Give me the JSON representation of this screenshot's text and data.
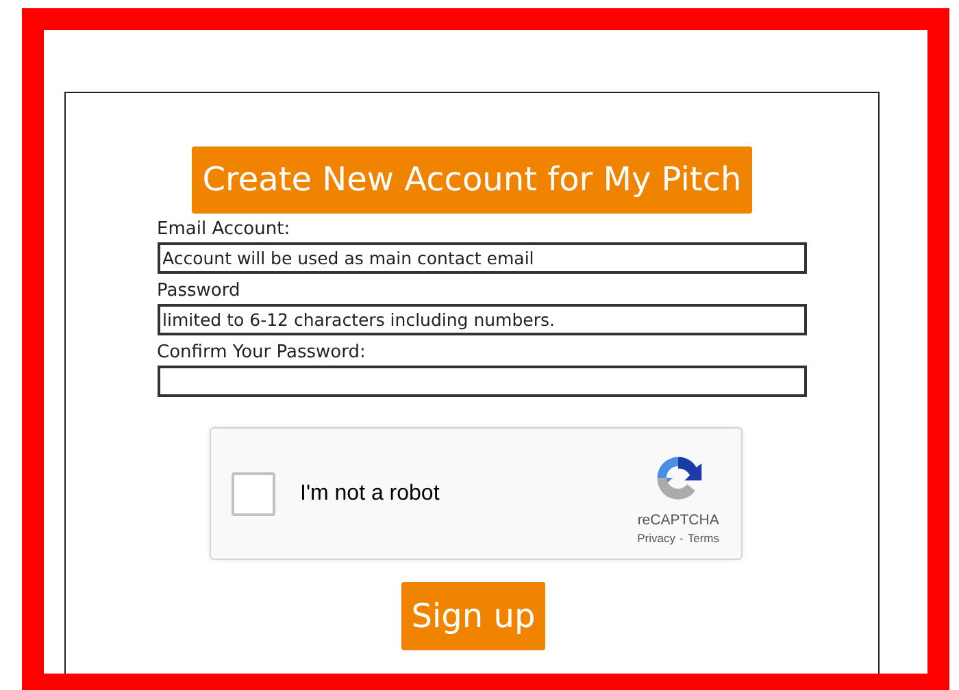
{
  "title": "Create New Account for My Pitch",
  "fields": [
    {
      "label": "Email Account:",
      "placeholder": "Account will be used as main contact email"
    },
    {
      "label": "Password",
      "placeholder": "limited to 6-12 characters including numbers."
    },
    {
      "label": "Confirm Your Password:"
    }
  ],
  "captcha": {
    "checked": false,
    "label": "I'm not a robot",
    "brand": "reCAPTCHA",
    "privacy": "Privacy",
    "separator": "-",
    "terms": "Terms"
  },
  "submit": "Sign up"
}
